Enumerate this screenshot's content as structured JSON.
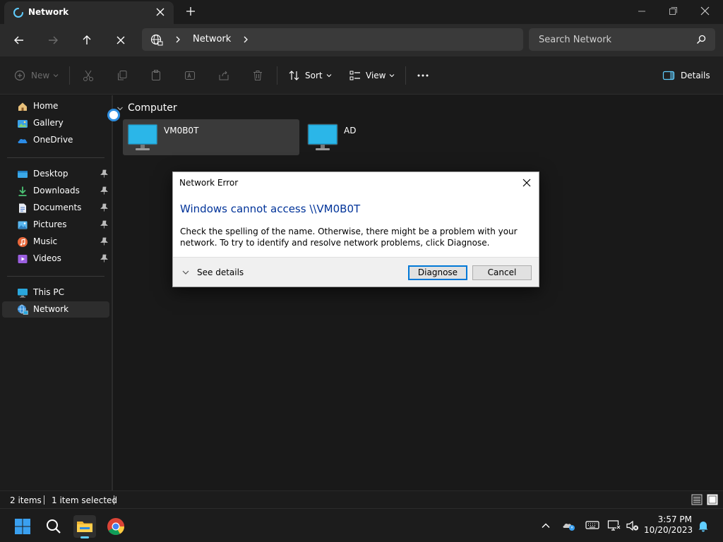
{
  "window": {
    "tab_title": "Network"
  },
  "address_bar": {
    "path": "Network",
    "search_placeholder": "Search Network"
  },
  "command_bar": {
    "new_label": "New",
    "sort_label": "Sort",
    "view_label": "View",
    "details_label": "Details"
  },
  "sidebar": {
    "items": [
      {
        "label": "Home",
        "icon": "home-icon"
      },
      {
        "label": "Gallery",
        "icon": "gallery-icon"
      },
      {
        "label": "OneDrive",
        "icon": "onedrive-icon"
      },
      {
        "label": "Desktop",
        "icon": "desktop-icon",
        "pinned": true
      },
      {
        "label": "Downloads",
        "icon": "downloads-icon",
        "pinned": true
      },
      {
        "label": "Documents",
        "icon": "documents-icon",
        "pinned": true
      },
      {
        "label": "Pictures",
        "icon": "pictures-icon",
        "pinned": true
      },
      {
        "label": "Music",
        "icon": "music-icon",
        "pinned": true
      },
      {
        "label": "Videos",
        "icon": "videos-icon",
        "pinned": true
      },
      {
        "label": "This PC",
        "icon": "this-pc-icon"
      },
      {
        "label": "Network",
        "icon": "network-icon",
        "selected": true
      }
    ]
  },
  "content": {
    "group_title": "Computer",
    "items": [
      {
        "name": "VM0B0T",
        "selected": true
      },
      {
        "name": "AD",
        "selected": false
      }
    ]
  },
  "status_bar": {
    "item_count": "2 items",
    "selection": "1 item selected"
  },
  "dialog": {
    "title": "Network Error",
    "heading": "Windows cannot access \\\\VM0B0T",
    "message": "Check the spelling of the name. Otherwise, there might be a problem with your network. To try to identify and resolve network problems, click Diagnose.",
    "details_label": "See details",
    "diagnose_label": "Diagnose",
    "cancel_label": "Cancel"
  },
  "taskbar": {
    "time": "3:57 PM",
    "date": "10/20/2023"
  },
  "colors": {
    "accent": "#0078d7",
    "dialog_heading": "#003399",
    "monitor_screen": "#1fa6d8"
  }
}
